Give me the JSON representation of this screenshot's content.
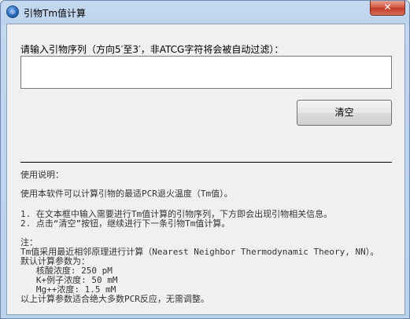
{
  "window": {
    "title": "引物Tm值计算",
    "icon": "dna-app-icon",
    "close_label": "✕"
  },
  "input": {
    "label_prefix": "请输入引物序列（方向5",
    "label_q1": "′",
    "label_mid": "至3",
    "label_q2": "′",
    "label_suffix": "，非ATCG字符将会被自动过滤）：",
    "value": "",
    "placeholder": ""
  },
  "buttons": {
    "clear_label": "清空"
  },
  "help": {
    "heading": "使用说明：",
    "intro": "使用本软件可以计算引物的最适PCR退火温度（Tm值）。",
    "steps": [
      "1. 在文本框中输入需要进行Tm值计算的引物序列，下方即会出现引物相关信息。",
      "2. 点击“清空”按钮，继续进行下一条引物Tm值计算。"
    ],
    "note_heading": "注：",
    "note_method": "Tm值采用最近相邻原理进行计算（Nearest Neighbor Thermodynamic Theory, NN）。",
    "defaults_heading": "默认计算参数为：",
    "params": [
      "   核酸浓度: 250 pM",
      "   K+例子浓度: 50 mM",
      "   Mg++浓度: 1.5 mM"
    ],
    "note_footer": "以上计算参数适合绝大多数PCR反应，无需调整。"
  }
}
